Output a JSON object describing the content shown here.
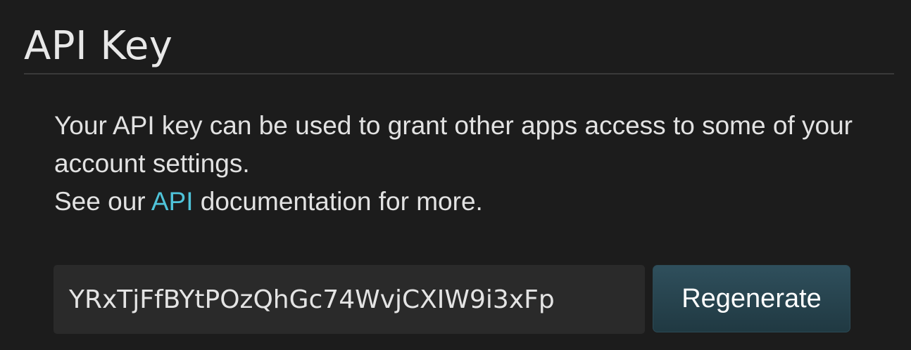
{
  "section": {
    "title": "API Key"
  },
  "description": {
    "line1": "Your API key can be used to grant other apps access to some of your account settings.",
    "line2_prefix": "See our ",
    "line2_link": "API",
    "line2_suffix": " documentation for more."
  },
  "api_key": {
    "value": "YRxTjFfBYtPOzQhGc74WvjCXIW9i3xFp"
  },
  "buttons": {
    "regenerate_label": "Regenerate"
  },
  "colors": {
    "background": "#1c1c1c",
    "link": "#4fc3d9",
    "button": "#2a4753"
  }
}
